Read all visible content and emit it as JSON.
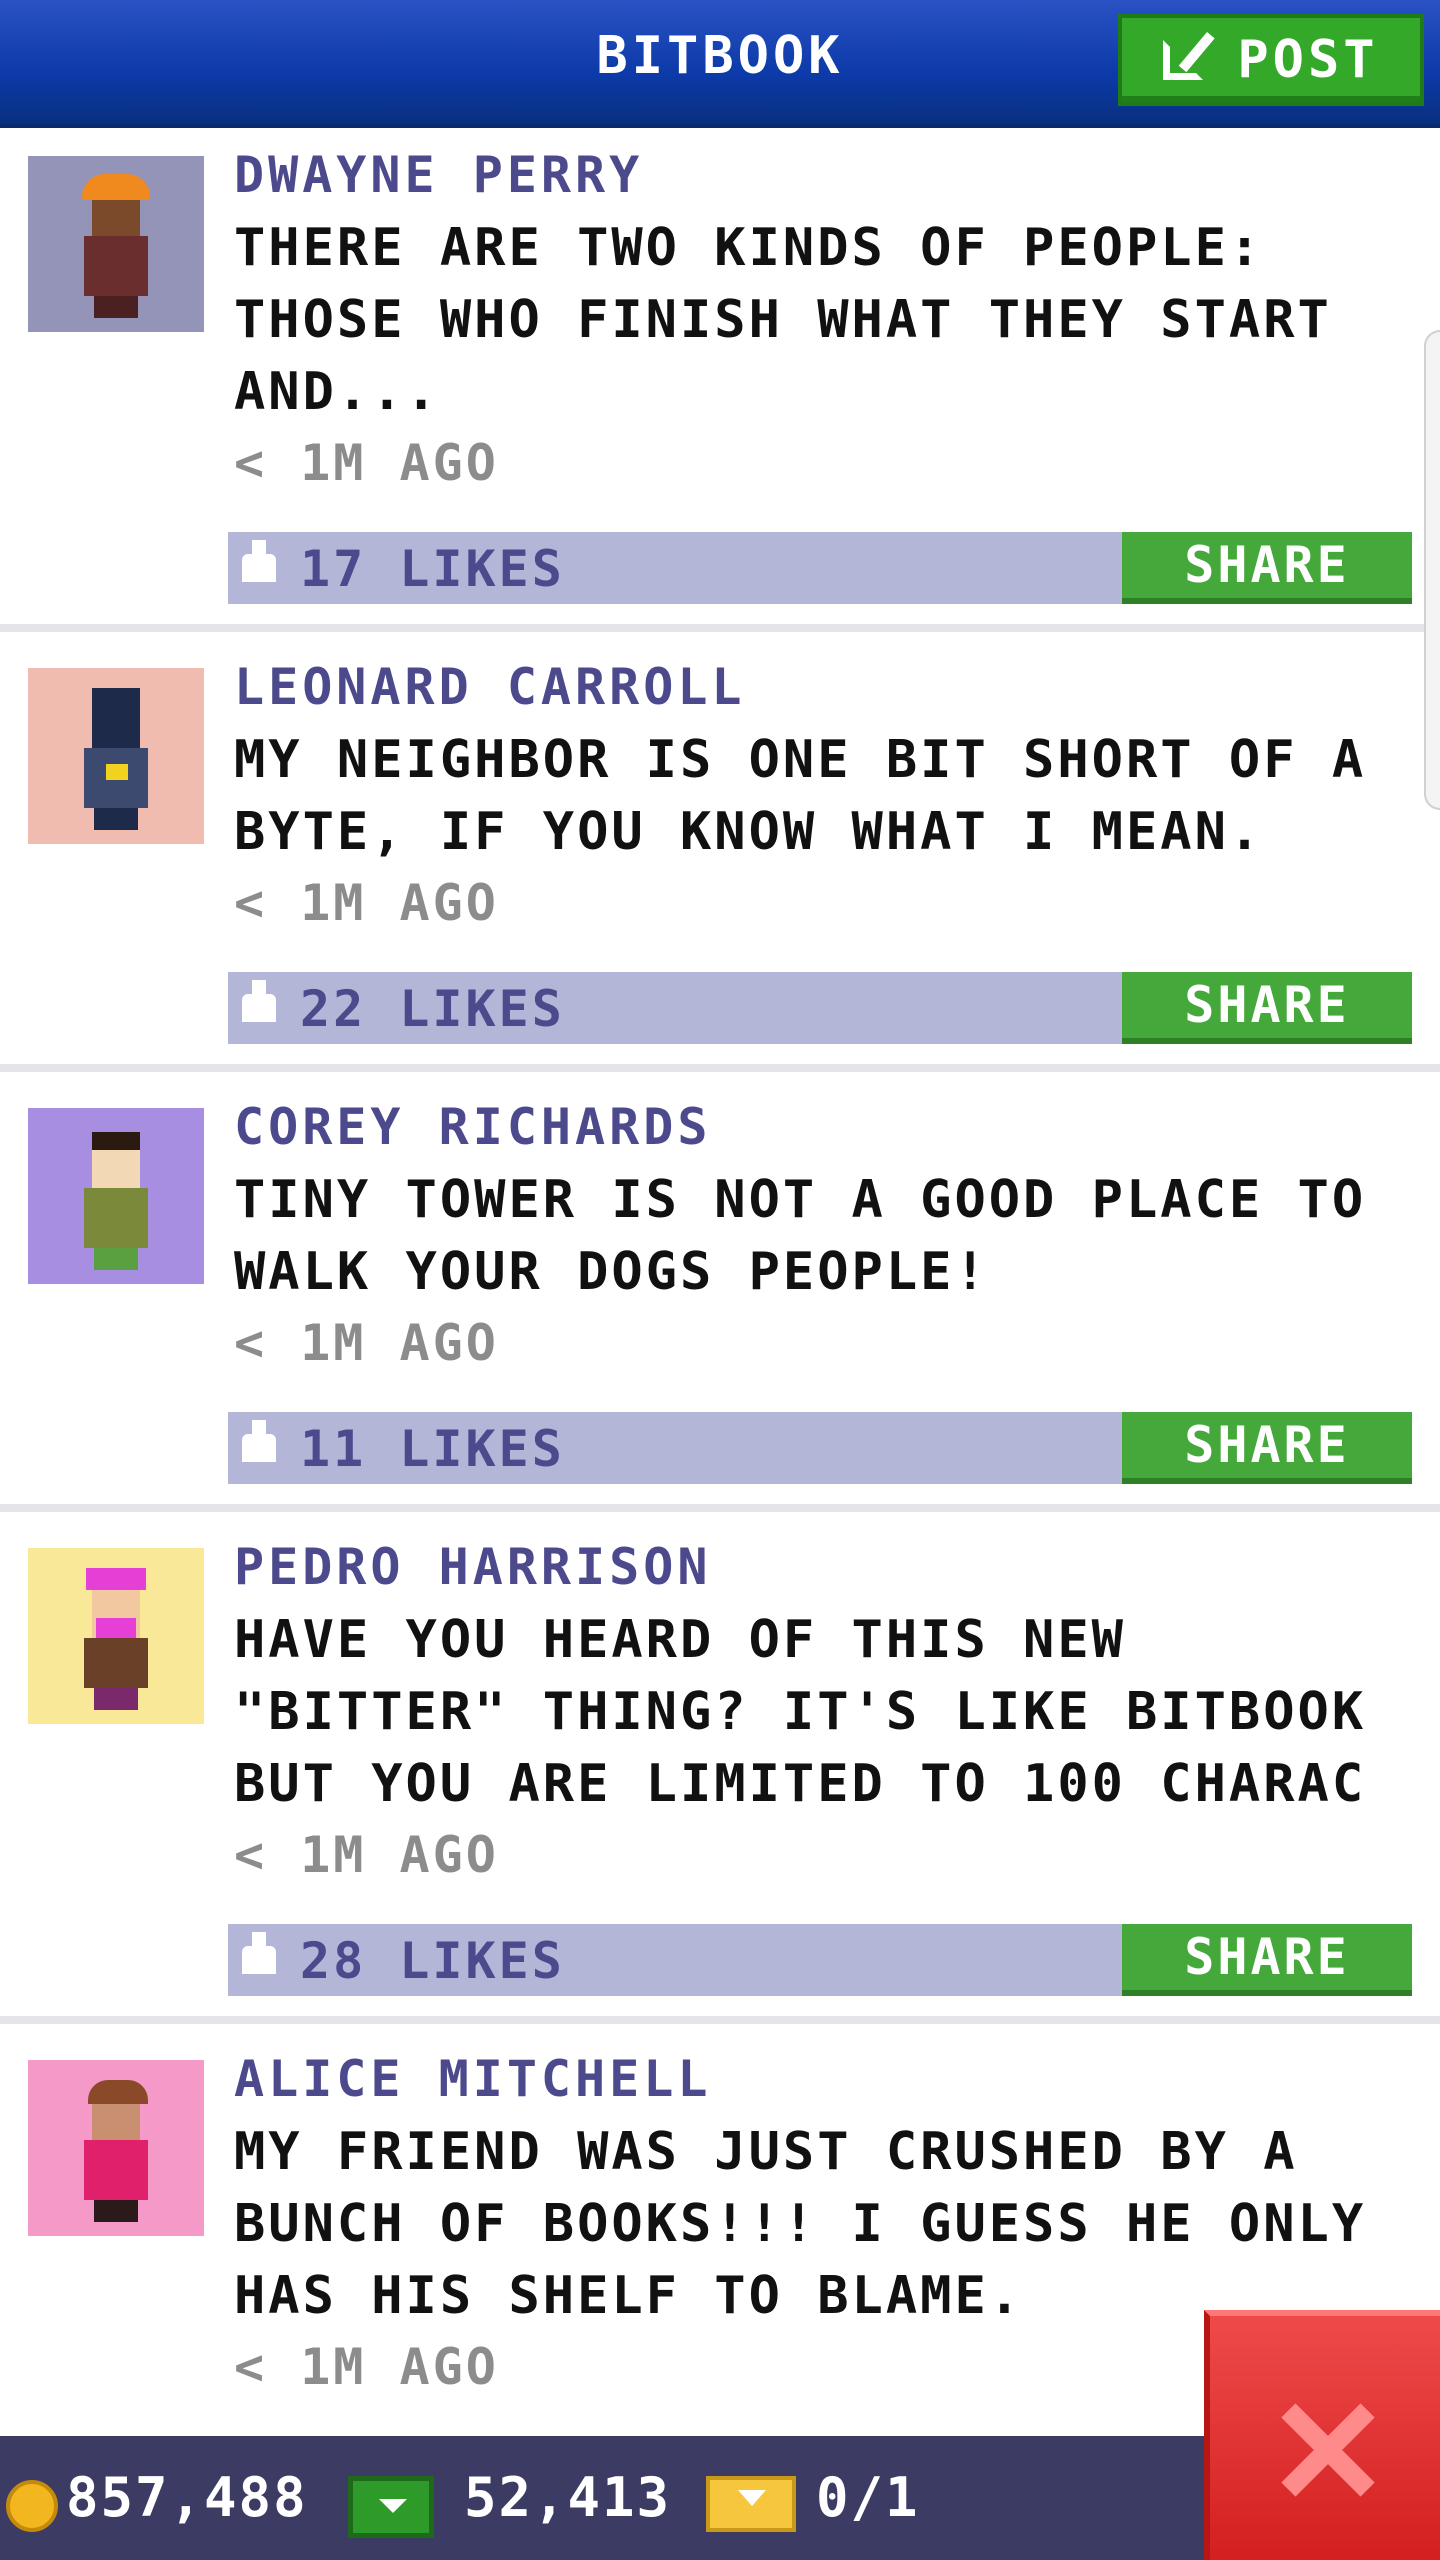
{
  "header": {
    "title": "BITBOOK",
    "post_label": "POST"
  },
  "posts": [
    {
      "name": "DWAYNE PERRY",
      "message": "THERE ARE TWO KINDS OF PEOPLE: THOSE WHO FINISH WHAT THEY START AND...",
      "time": "< 1M AGO",
      "likes": "17 LIKES",
      "share_label": "SHARE",
      "avatar_bg": "#9494b8"
    },
    {
      "name": "LEONARD CARROLL",
      "message": "MY NEIGHBOR IS ONE BIT SHORT OF A BYTE, IF YOU KNOW WHAT I MEAN.",
      "time": "< 1M AGO",
      "likes": "22 LIKES",
      "share_label": "SHARE",
      "avatar_bg": "#f0bcb0"
    },
    {
      "name": "COREY RICHARDS",
      "message": "TINY TOWER IS NOT A GOOD PLACE TO WALK YOUR DOGS PEOPLE!",
      "time": "< 1M AGO",
      "likes": "11 LIKES",
      "share_label": "SHARE",
      "avatar_bg": "#a88ee0"
    },
    {
      "name": "PEDRO HARRISON",
      "message": "HAVE YOU HEARD OF THIS NEW \"BITTER\" THING? IT'S LIKE BITBOOK BUT YOU ARE LIMITED TO 100 CHARAC",
      "time": "< 1M AGO",
      "likes": "28 LIKES",
      "share_label": "SHARE",
      "avatar_bg": "#f8e898"
    },
    {
      "name": "ALICE MITCHELL",
      "message": "MY FRIEND WAS JUST CRUSHED BY A BUNCH OF BOOKS!!! I GUESS HE ONLY HAS HIS SHELF TO BLAME.",
      "time": "< 1M AGO",
      "likes": "",
      "share_label": "",
      "avatar_bg": "#f59ac8"
    }
  ],
  "status": {
    "coins": "857,488",
    "bux": "52,413",
    "tickets": "0/1"
  },
  "icons": {
    "compose": "compose-icon",
    "like": "thumbs-up-icon",
    "coin": "coin-icon",
    "bux": "bux-icon",
    "ticket": "ticket-icon",
    "close": "close-icon"
  }
}
